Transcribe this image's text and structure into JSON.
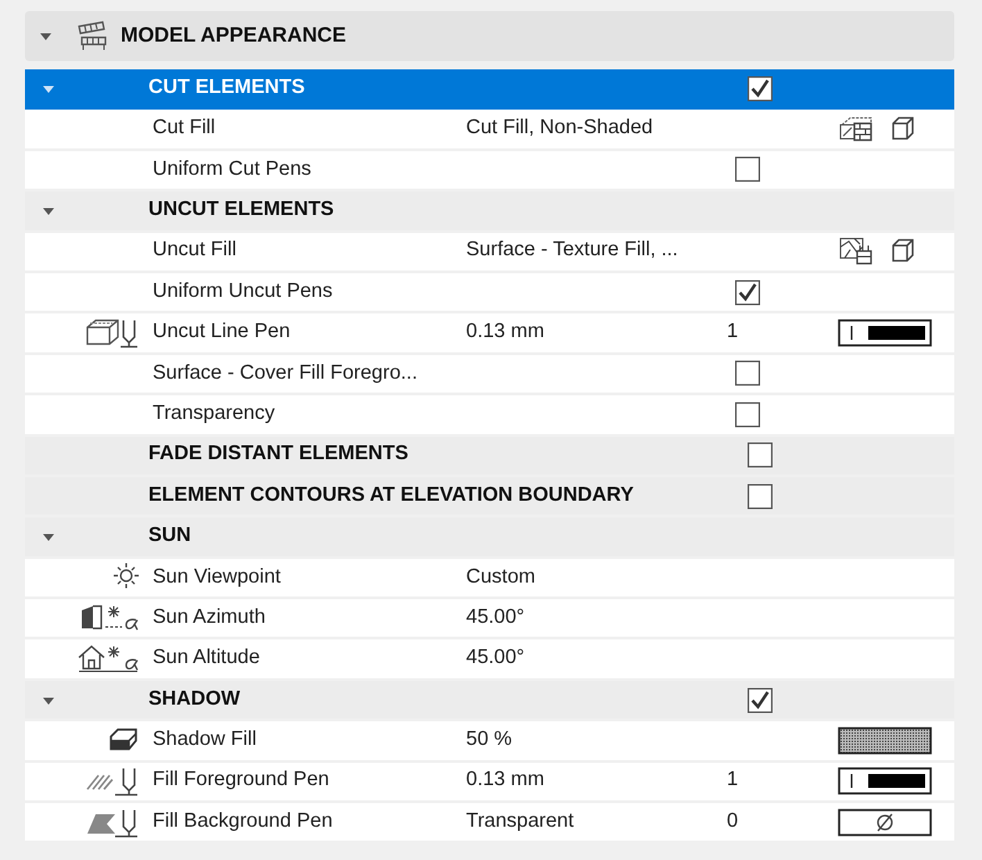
{
  "panel": {
    "title": "MODEL APPEARANCE",
    "expanded": true
  },
  "rows": [
    {
      "kind": "group",
      "label": "CUT ELEMENTS",
      "expanded": true,
      "selected": true,
      "checked": true
    },
    {
      "kind": "prop",
      "label": "Cut Fill",
      "value": "Cut Fill, Non-Shaded"
    },
    {
      "kind": "prop",
      "label": "Uniform Cut Pens",
      "checked": false
    },
    {
      "kind": "group",
      "label": "UNCUT ELEMENTS",
      "expanded": true,
      "selected": false
    },
    {
      "kind": "prop",
      "label": "Uncut Fill",
      "value": "Surface - Texture Fill, ..."
    },
    {
      "kind": "prop",
      "label": "Uniform Uncut Pens",
      "checked": true
    },
    {
      "kind": "prop",
      "label": "Uncut Line Pen",
      "value": "0.13 mm",
      "number": "1"
    },
    {
      "kind": "prop",
      "label": "Surface - Cover Fill Foregro...",
      "checked": false
    },
    {
      "kind": "prop",
      "label": "Transparency",
      "checked": false
    },
    {
      "kind": "group",
      "label": "FADE DISTANT ELEMENTS",
      "selected": false,
      "checked": false
    },
    {
      "kind": "group",
      "label": "ELEMENT CONTOURS AT ELEVATION BOUNDARY",
      "selected": false,
      "checked": false
    },
    {
      "kind": "group",
      "label": "SUN",
      "expanded": true,
      "selected": false
    },
    {
      "kind": "prop",
      "label": "Sun Viewpoint",
      "value": "Custom"
    },
    {
      "kind": "prop",
      "label": "Sun Azimuth",
      "value": "45.00°"
    },
    {
      "kind": "prop",
      "label": "Sun Altitude",
      "value": "45.00°"
    },
    {
      "kind": "group",
      "label": "SHADOW",
      "expanded": true,
      "selected": false,
      "checked": true
    },
    {
      "kind": "prop",
      "label": "Shadow Fill",
      "value": "50 %"
    },
    {
      "kind": "prop",
      "label": "Fill Foreground Pen",
      "value": "0.13 mm",
      "number": "1"
    },
    {
      "kind": "prop",
      "label": "Fill Background Pen",
      "value": "Transparent",
      "number": "0"
    }
  ]
}
